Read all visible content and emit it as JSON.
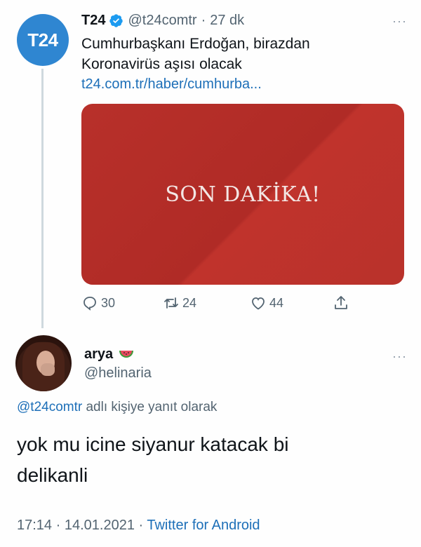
{
  "parent_tweet": {
    "avatar_text": "T24",
    "name": "T24",
    "handle": "@t24comtr",
    "separator": "·",
    "time": "27 dk",
    "more": "···",
    "text_line1": "Cumhurbaşkanı Erdoğan, birazdan",
    "text_line2": "Koronavirüs aşısı olacak",
    "link": "t24.com.tr/haber/cumhurba...",
    "card_text": "SON DAKİKA!",
    "reply_count": "30",
    "retweet_count": "24",
    "like_count": "44",
    "brand_color": "#2f86d1",
    "card_color": "#b8302a"
  },
  "reply_tweet": {
    "name": "arya",
    "name_emoji": "watermelon-icon",
    "handle": "@helinaria",
    "more": "···",
    "replying_mention": "@t24comtr",
    "replying_suffix": " adlı kişiye yanıt olarak",
    "text_line1": "yok mu icine siyanur katacak bi",
    "text_line2": "delikanli",
    "time": "17:14",
    "dot1": " · ",
    "date": "14.01.2021",
    "dot2": " · ",
    "client": "Twitter for Android"
  }
}
